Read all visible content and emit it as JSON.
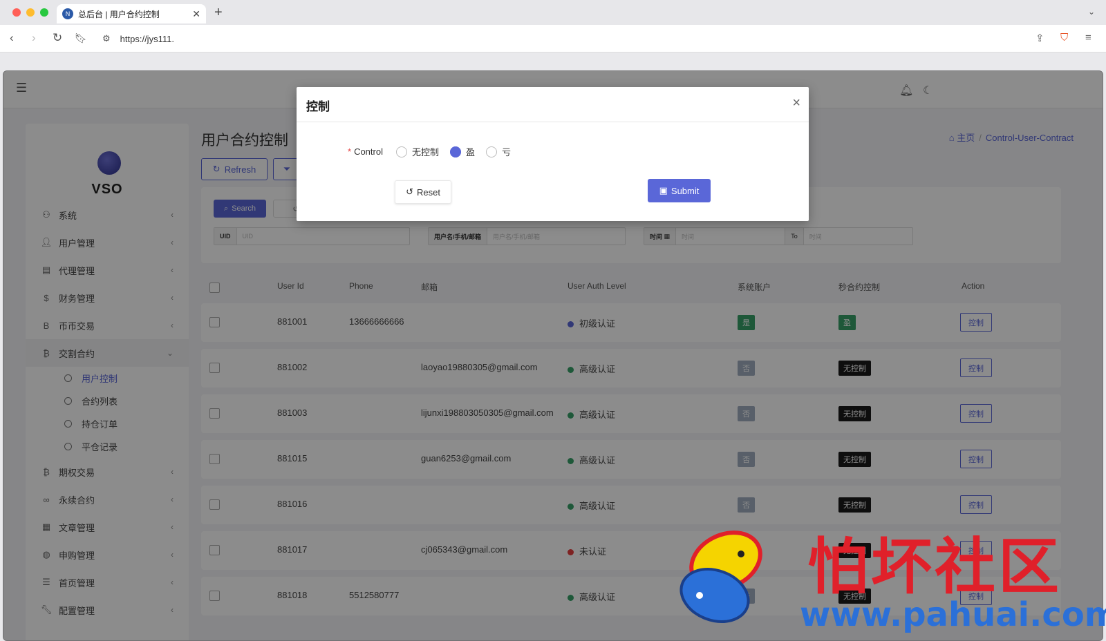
{
  "browser": {
    "tab_title": "总后台 | 用户合约控制",
    "url": "https://jys111."
  },
  "sidebar": {
    "logo_text": "VSO",
    "items": [
      {
        "label": "系统",
        "icon": "group-icon"
      },
      {
        "label": "用户管理",
        "icon": "user-icon"
      },
      {
        "label": "代理管理",
        "icon": "id-card-icon"
      },
      {
        "label": "财务管理",
        "icon": "dollar-icon"
      },
      {
        "label": "币币交易",
        "icon": "bitcoin-icon"
      },
      {
        "label": "交割合约",
        "icon": "bitcoin-icon"
      },
      {
        "label": "期权交易",
        "icon": "bitcoin-icon"
      },
      {
        "label": "永续合约",
        "icon": "link-icon"
      },
      {
        "label": "文章管理",
        "icon": "newspaper-icon"
      },
      {
        "label": "申购管理",
        "icon": "globe-icon"
      },
      {
        "label": "首页管理",
        "icon": "list-icon"
      },
      {
        "label": "配置管理",
        "icon": "wrench-icon"
      }
    ],
    "subitems": [
      "用户控制",
      "合约列表",
      "持仓订单",
      "平仓记录"
    ]
  },
  "main": {
    "title": "用户合约控制",
    "refresh_label": "Refresh",
    "breadcrumb_home": "主页",
    "breadcrumb_current": "Control-User-Contract"
  },
  "search": {
    "search_label": "Search",
    "uid_label": "UID",
    "uid_placeholder": "UID",
    "user_label": "用户名/手机/邮箱",
    "user_placeholder": "用户名/手机/邮箱",
    "time_label": "时间",
    "time_placeholder": "时间",
    "to_label": "To",
    "to_placeholder": "时间"
  },
  "table": {
    "headers": [
      "User Id",
      "Phone",
      "邮箱",
      "User Auth Level",
      "系统账户",
      "秒合约控制",
      "Action"
    ],
    "action_label": "控制",
    "rows": [
      {
        "id": "881001",
        "phone": "13666666666",
        "email": "",
        "auth": "初级认证",
        "auth_color": "#5a67d8",
        "sys": "是",
        "sys_color": "#38a169",
        "ctrl": "盈",
        "ctrl_color": "#38a169"
      },
      {
        "id": "881002",
        "phone": "",
        "email": "laoyao19880305@gmail.com",
        "auth": "高级认证",
        "auth_color": "#38a169",
        "sys": "否",
        "sys_color": "#a0aec0",
        "ctrl": "无控制",
        "ctrl_color": "#1a1a1a"
      },
      {
        "id": "881003",
        "phone": "",
        "email": "lijunxi198803050305@gmail.com",
        "auth": "高级认证",
        "auth_color": "#38a169",
        "sys": "否",
        "sys_color": "#a0aec0",
        "ctrl": "无控制",
        "ctrl_color": "#1a1a1a"
      },
      {
        "id": "881015",
        "phone": "",
        "email": "guan6253@gmail.com",
        "auth": "高级认证",
        "auth_color": "#38a169",
        "sys": "否",
        "sys_color": "#a0aec0",
        "ctrl": "无控制",
        "ctrl_color": "#1a1a1a"
      },
      {
        "id": "881016",
        "phone": "",
        "email": "",
        "auth": "高级认证",
        "auth_color": "#38a169",
        "sys": "否",
        "sys_color": "#a0aec0",
        "ctrl": "无控制",
        "ctrl_color": "#1a1a1a"
      },
      {
        "id": "881017",
        "phone": "",
        "email": "cj065343@gmail.com",
        "auth": "未认证",
        "auth_color": "#e53e3e",
        "sys": "否",
        "sys_color": "#a0aec0",
        "ctrl": "无控制",
        "ctrl_color": "#1a1a1a"
      },
      {
        "id": "881018",
        "phone": "5512580777",
        "email": "",
        "auth": "高级认证",
        "auth_color": "#38a169",
        "sys": "否",
        "sys_color": "#a0aec0",
        "ctrl": "无控制",
        "ctrl_color": "#1a1a1a"
      }
    ]
  },
  "modal": {
    "title": "控制",
    "control_label": "Control",
    "options": [
      "无控制",
      "盈",
      "亏"
    ],
    "selected_option": "盈",
    "reset_label": "Reset",
    "submit_label": "Submit"
  },
  "watermark": {
    "text": "怕坏社区",
    "url": "www.pahuai.com"
  },
  "colors": {
    "accent": "#5a67d8",
    "watermark_red": "#e0202a",
    "watermark_blue": "#2b70d8"
  }
}
